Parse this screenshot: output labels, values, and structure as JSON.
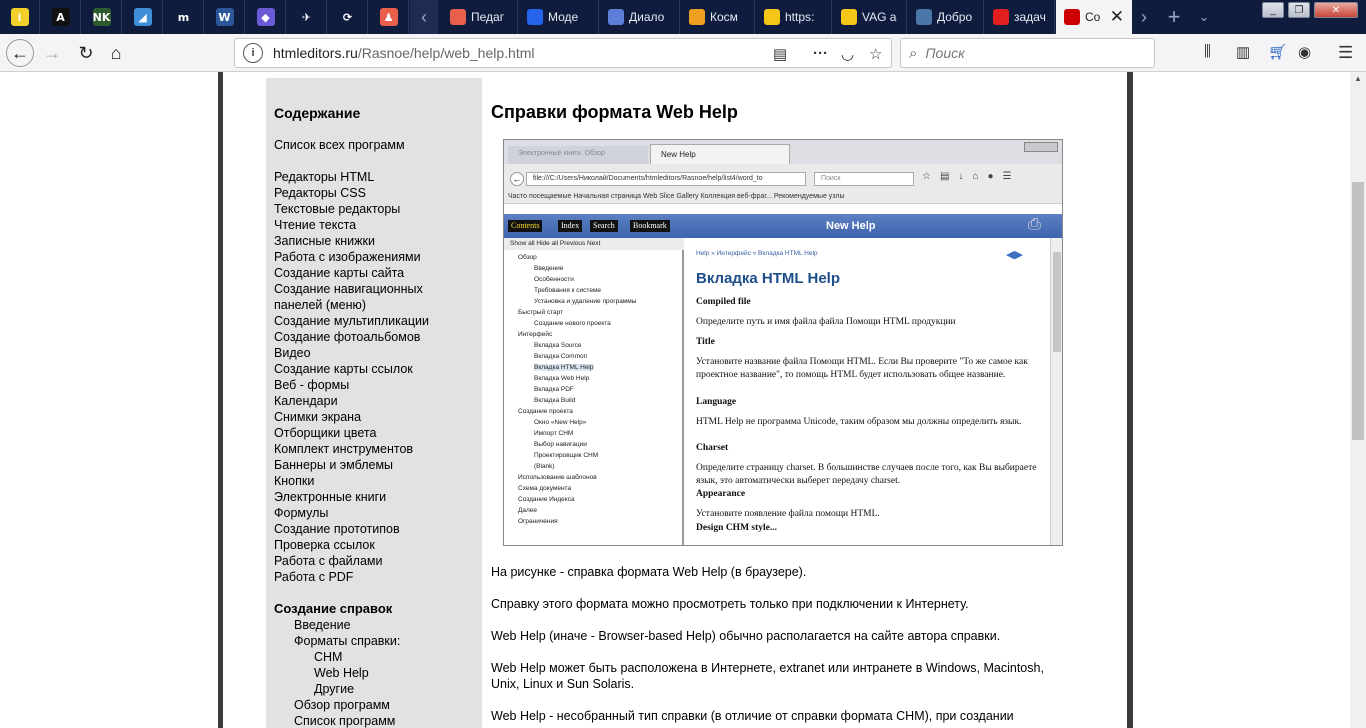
{
  "browser": {
    "pinned_tabs": [
      {
        "icon": "i-letter-icon",
        "color": "#f2d02a",
        "glyph": "i"
      },
      {
        "icon": "a-logo-icon",
        "color": "#111111",
        "glyph": "A"
      },
      {
        "icon": "nk-logo-icon",
        "color": "#2e5c2e",
        "glyph": "NK"
      },
      {
        "icon": "bird-app-icon",
        "color": "#3f8fd8",
        "glyph": "◢"
      },
      {
        "icon": "m-logo-icon",
        "color": "#0f1c3e",
        "glyph": "m"
      },
      {
        "icon": "word-icon",
        "color": "#2b579a",
        "glyph": "W"
      },
      {
        "icon": "diamond-icon",
        "color": "#6b5ad6",
        "glyph": "◆"
      },
      {
        "icon": "rocket-icon",
        "color": "#0f1c3e",
        "glyph": "✈"
      },
      {
        "icon": "swirl-icon",
        "color": "#0f1c3e",
        "glyph": "⟳"
      },
      {
        "icon": "person-icon",
        "color": "#e8604c",
        "glyph": "♟"
      }
    ],
    "tabs": [
      {
        "label": "Педаг",
        "icon": "person-icon",
        "color": "#e8604c"
      },
      {
        "label": "Моде",
        "icon": "bar-icon",
        "color": "#2563eb"
      },
      {
        "label": "Диало",
        "icon": "chat-icon",
        "color": "#5b7fd6"
      },
      {
        "label": "Косм",
        "icon": "check-icon",
        "color": "#f0a020"
      },
      {
        "label": "https:",
        "icon": "smile-icon",
        "color": "#f5c518"
      },
      {
        "label": "VAG а",
        "icon": "smile-icon",
        "color": "#f5c518"
      },
      {
        "label": "Добро",
        "icon": "vk-icon",
        "color": "#4a76a8"
      },
      {
        "label": "задач",
        "icon": "yandex-icon",
        "color": "#e02020"
      },
      {
        "label": "Со",
        "icon": "ussr-flag-icon",
        "color": "#cc0000"
      }
    ],
    "url": {
      "host": "htmleditors.ru",
      "path": "/Rasnoe/help/web_help.html"
    },
    "search_placeholder": "Поиск"
  },
  "sidebar": {
    "heading": "Содержание",
    "all_programs": "Список всех программ",
    "items": [
      "Редакторы HTML",
      "Редакторы CSS",
      "Текстовые редакторы",
      "Чтение текста",
      "Записные книжки",
      "Работа с изображениями",
      "Создание карты сайта",
      "Создание навигационных",
      "панелей (меню)",
      "Создание мультипликации",
      "Создание фотоальбомов",
      "Видео",
      "Создание карты ссылок",
      "Веб - формы",
      "Календари",
      "Снимки экрана",
      "Отборщики цвета",
      "Комплект инструментов",
      "Баннеры и эмблемы",
      "Кнопки",
      "Электронные книги",
      "Формулы",
      "Создание прототипов",
      "Проверка ссылок",
      "Работа с файлами",
      "Работа с PDF"
    ],
    "section2_heading": "Создание справок",
    "section2_items": [
      "Введение",
      "Форматы справки:"
    ],
    "formats": [
      "CHM",
      "Web Help",
      "Другие"
    ],
    "section2_tail": [
      "Обзор программ",
      "Список программ"
    ]
  },
  "main": {
    "title": "Справки формата Web Help",
    "paragraphs": [
      "На рисунке - справка формата Web Help (в браузере).",
      "Справку этого формата можно просмотреть только при подключении к Интернету.",
      "Web Help (иначе - Browser-based Help) обычно располагается на сайте автора справки.",
      "Web Help может быть расположена в Интернете, extranet или интранете в Windows, Macintosh, Unix, Linux и Sun Solaris.",
      "Web Help - несобранный тип справки (в отличие от справки формата CHM), при создании"
    ]
  },
  "screenshot": {
    "tab1": "Электронные книги. Обзор",
    "tab2": "New Help",
    "url": "file:///C:/Users/Николай/Documents/htmleditors/Rasnoe/help/list4/word_to",
    "search": "Поиск",
    "bookmarks": "Часто посещаемые   Начальная страница   Web Slice Gallery   Коллекция веб-фраг...   Рекомендуемые узлы",
    "header_tabs": [
      "Contents",
      "Index",
      "Search",
      "Bookmark"
    ],
    "header_title": "New Help",
    "toc_bar": "Show all   Hide all   Previous   Next",
    "toc": [
      "Обзор",
      "Введение",
      "Особенности",
      "Требования к системе",
      "Установка и удаление программы",
      "Быстрый старт",
      "Создание нового проекта",
      "Интерфейс",
      "Вкладка Source",
      "Вкладка Common",
      "Вкладка HTML Help",
      "Вкладка Web Help",
      "Вкладка PDF",
      "Вкладка Build",
      "Создание проекта",
      "Окно «New Help»",
      "Импорт CHM",
      "Выбор навигации",
      "Проектировщик CHM",
      "(Blank)",
      "Использование шаблонов",
      "Схема документа",
      "Создание Индекса",
      "Далее",
      "Ограничения"
    ],
    "breadcrumb": "Help » Интерфейс » Вкладка HTML Help",
    "help_title": "Вкладка HTML Help",
    "blocks": [
      {
        "bold": true,
        "text": "Compiled file"
      },
      {
        "bold": false,
        "text": "Определите путь и имя файла файла Помощи HTML продукции"
      },
      {
        "bold": true,
        "text": "Title"
      },
      {
        "bold": false,
        "text": "Установите название файла Помощи HTML. Если Вы проверите \"То же самое как проектное название\", то помощь HTML будет использовать общее название."
      },
      {
        "bold": true,
        "text": "Language"
      },
      {
        "bold": false,
        "text": "HTML Help не программа Unicode, таким образом мы должны определить язык."
      },
      {
        "bold": true,
        "text": "Charset"
      },
      {
        "bold": false,
        "text": "Определите страницу charset. В большинстве случаев после того, как Вы выбираете язык, это автоматически выберет передачу charset."
      },
      {
        "bold": true,
        "text": "Appearance"
      },
      {
        "bold": false,
        "text": "Установите появление файла помощи HTML."
      },
      {
        "bold": true,
        "text": "Design CHM style..."
      }
    ]
  }
}
